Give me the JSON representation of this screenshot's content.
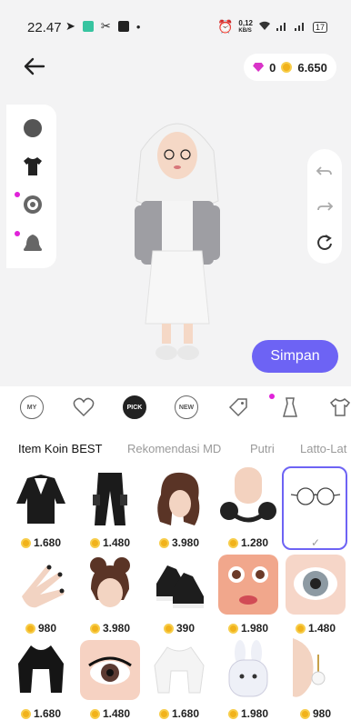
{
  "status_bar": {
    "time": "22.47",
    "net_speed": "0,12",
    "net_unit": "KB/S",
    "battery": "17"
  },
  "header": {
    "gems": "0",
    "coins": "6.650"
  },
  "actions": {
    "save_label": "Simpan"
  },
  "tabs": [
    {
      "name": "MY",
      "label": "MY"
    },
    {
      "name": "favorites",
      "label": ""
    },
    {
      "name": "PICK",
      "label": "PICK"
    },
    {
      "name": "NEW",
      "label": "NEW"
    },
    {
      "name": "tag",
      "label": ""
    },
    {
      "name": "outfit",
      "label": ""
    },
    {
      "name": "wardrobe",
      "label": ""
    }
  ],
  "categories": [
    "Item Koin BEST",
    "Rekomendasi MD",
    "Putri",
    "Latto-Lat"
  ],
  "items": [
    {
      "icon": "varsity-jacket",
      "price": "1.680"
    },
    {
      "icon": "cargo-pants",
      "price": "1.480"
    },
    {
      "icon": "wavy-hair",
      "price": "3.980"
    },
    {
      "icon": "headphones",
      "price": "1.280"
    },
    {
      "icon": "round-glasses",
      "price": "",
      "selected": true
    },
    {
      "icon": "manicure-hand",
      "price": "980"
    },
    {
      "icon": "bun-hair",
      "price": "3.980"
    },
    {
      "icon": "sneakers",
      "price": "390"
    },
    {
      "icon": "face-makeup",
      "price": "1.980"
    },
    {
      "icon": "eye-lens",
      "price": "1.480"
    },
    {
      "icon": "black-top",
      "price": "1.680"
    },
    {
      "icon": "eye-lashes",
      "price": "1.480"
    },
    {
      "icon": "white-top",
      "price": "1.680"
    },
    {
      "icon": "bunny-bag",
      "price": "1.980"
    },
    {
      "icon": "pearl-earring",
      "price": "980"
    }
  ],
  "colors": {
    "accent": "#6d63f4",
    "dot": "#e022d9",
    "coin": "#f1b21b"
  }
}
